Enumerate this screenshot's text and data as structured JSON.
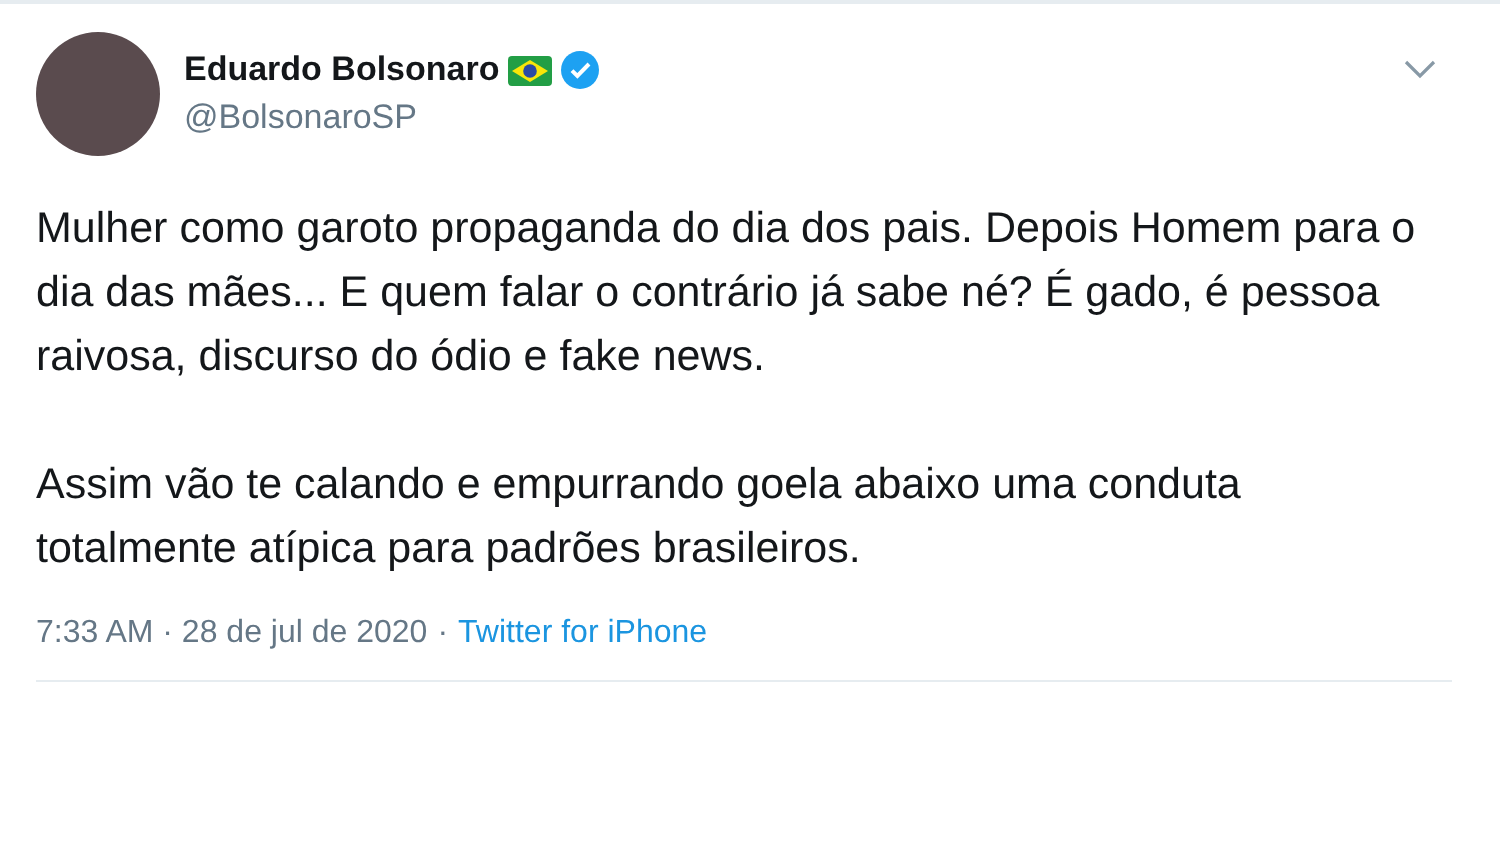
{
  "author": {
    "name": "Eduardo Bolsonaro",
    "handle": "@BolsonaroSP",
    "verified": true
  },
  "paragraphs": [
    "Mulher como garoto propaganda do dia dos pais. Depois Homem para o dia das mães... E quem falar o contrário já sabe né? É gado, é pessoa raivosa, discurso do ódio e fake news.",
    "Assim vão te calando e empurrando goela abaixo uma conduta totalmente atípica para padrões brasileiros."
  ],
  "footer": {
    "timestamp": "7:33 AM · 28 de jul de 2020",
    "separator": "·",
    "source": "Twitter for iPhone"
  }
}
